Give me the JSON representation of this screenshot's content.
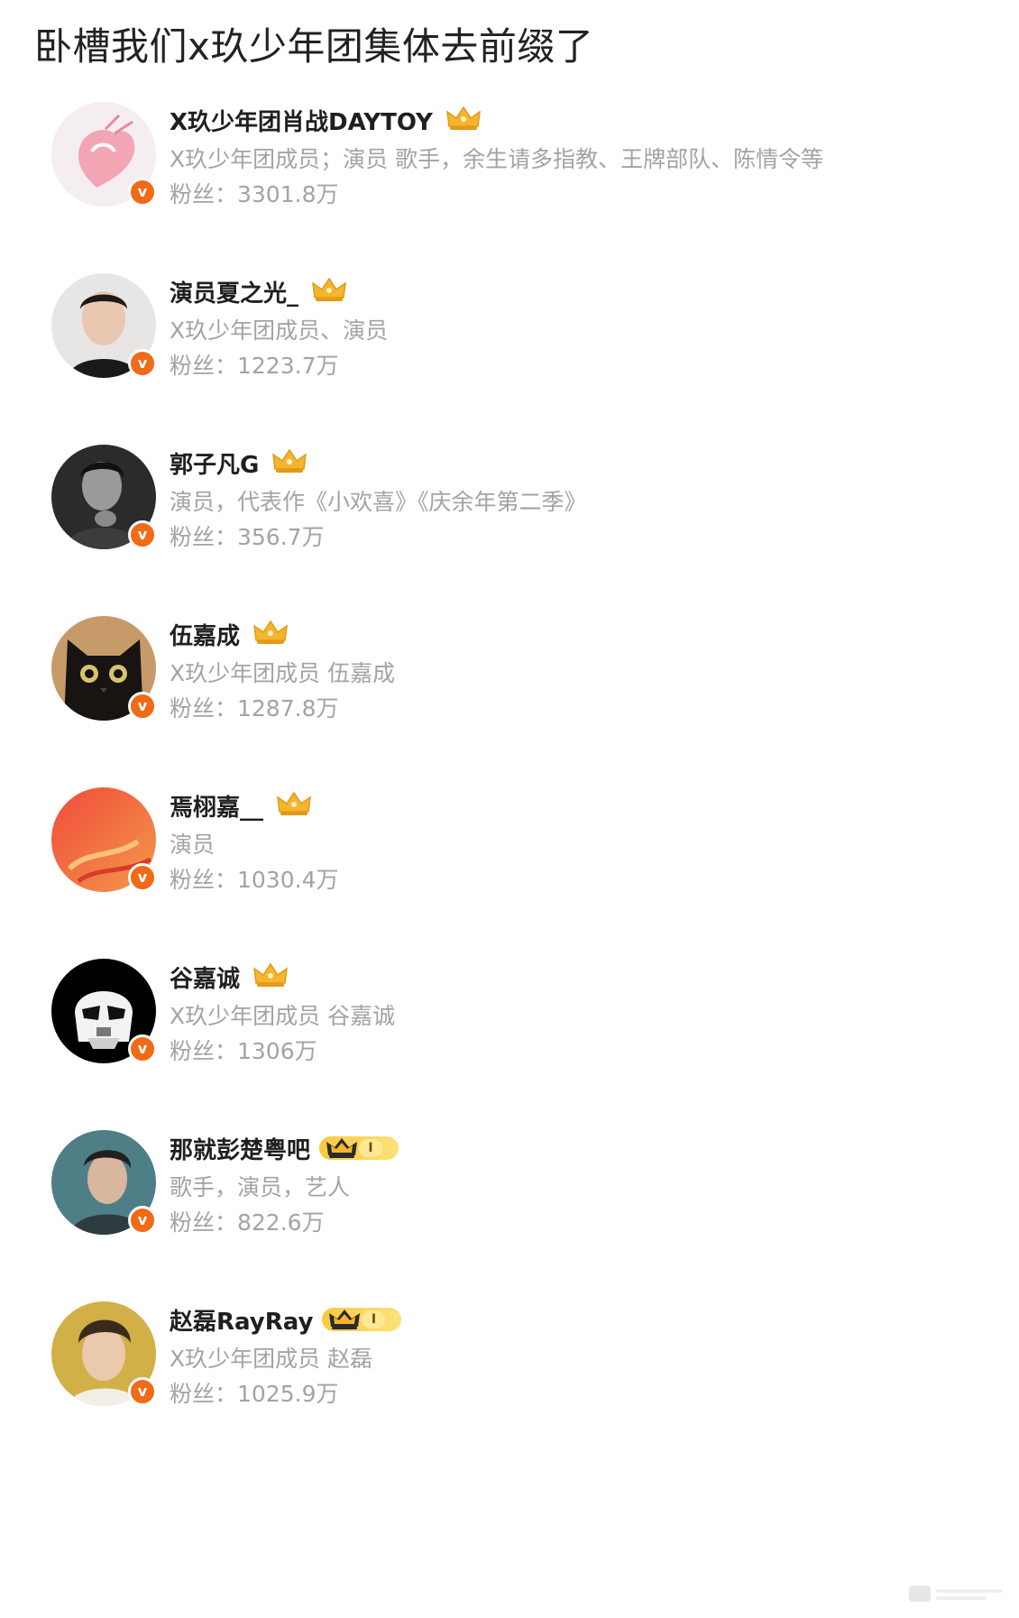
{
  "post": {
    "title": "卧槽我们x玖少年团集体去前缀了"
  },
  "users": [
    {
      "name": "X玖少年团肖战DAYTOY",
      "description": "X玖少年团成员；演员 歌手，余生请多指教、王牌部队、陈情令等",
      "fans": "粉丝：3301.8万",
      "badge": "crown-icon",
      "avatar": "pink-heart-avatar"
    },
    {
      "name": "演员夏之光_",
      "description": "X玖少年团成员、演员",
      "fans": "粉丝：1223.7万",
      "badge": "crown-icon",
      "avatar": "portrait-avatar"
    },
    {
      "name": "郭子凡G",
      "description": "演员，代表作《小欢喜》《庆余年第二季》",
      "fans": "粉丝：356.7万",
      "badge": "crown-icon",
      "avatar": "bw-portrait-avatar"
    },
    {
      "name": "伍嘉成",
      "description": "X玖少年团成员 伍嘉成",
      "fans": "粉丝：1287.8万",
      "badge": "crown-icon",
      "avatar": "black-cat-avatar"
    },
    {
      "name": "焉栩嘉__",
      "description": "演员",
      "fans": "粉丝：1030.4万",
      "badge": "crown-icon",
      "avatar": "red-orange-avatar"
    },
    {
      "name": "谷嘉诚",
      "description": "X玖少年团成员 谷嘉诚",
      "fans": "粉丝：1306万",
      "badge": "crown-icon",
      "avatar": "stormtrooper-avatar"
    },
    {
      "name": "那就彭楚粤吧",
      "description": "歌手，演员，艺人",
      "fans": "粉丝：822.6万",
      "badge": "crown-level-icon",
      "level": "I",
      "avatar": "portrait-avatar"
    },
    {
      "name": "赵磊RayRay",
      "description": "X玖少年团成员 赵磊",
      "fans": "粉丝：1025.9万",
      "badge": "crown-level-icon",
      "level": "I",
      "avatar": "portrait-avatar"
    }
  ],
  "colors": {
    "verified": "#f06a18",
    "crown": "#f5b52e",
    "text_primary": "#1f1f1f",
    "text_secondary": "#a3a3a3"
  }
}
